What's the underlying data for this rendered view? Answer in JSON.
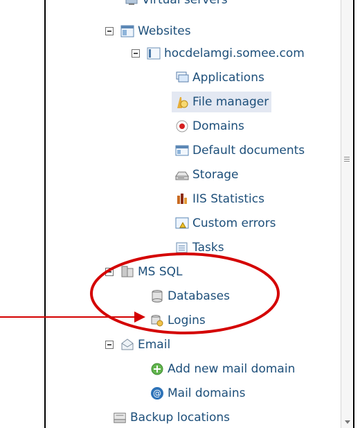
{
  "tree": {
    "virtual_servers": {
      "label": "Virtual servers",
      "icon": "virtual-servers-icon"
    },
    "websites": {
      "label": "Websites",
      "icon": "websites-icon"
    },
    "site": {
      "label": "hocdelamgi.somee.com",
      "icon": "site-icon"
    },
    "items": [
      {
        "label": "Applications",
        "icon": "applications-icon"
      },
      {
        "label": "File manager",
        "icon": "file-manager-icon"
      },
      {
        "label": "Domains",
        "icon": "domains-icon"
      },
      {
        "label": "Default documents",
        "icon": "default-documents-icon"
      },
      {
        "label": "Storage",
        "icon": "storage-icon"
      },
      {
        "label": "IIS Statistics",
        "icon": "iis-statistics-icon"
      },
      {
        "label": "Custom errors",
        "icon": "custom-errors-icon"
      },
      {
        "label": "Tasks",
        "icon": "tasks-icon"
      }
    ],
    "mssql": {
      "label": "MS SQL",
      "icon": "ms-sql-icon"
    },
    "mssql_items": [
      {
        "label": "Databases",
        "icon": "databases-icon"
      },
      {
        "label": "Logins",
        "icon": "logins-icon"
      }
    ],
    "email": {
      "label": "Email",
      "icon": "email-icon"
    },
    "email_items": [
      {
        "label": "Add new mail domain",
        "icon": "add-mail-domain-icon"
      },
      {
        "label": "Mail domains",
        "icon": "mail-domains-icon"
      }
    ],
    "backup": {
      "label": "Backup locations",
      "icon": "backup-locations-icon"
    }
  },
  "annotation_color": "#d40000",
  "text_color": "#1d4f7a",
  "selected_item": "File manager"
}
